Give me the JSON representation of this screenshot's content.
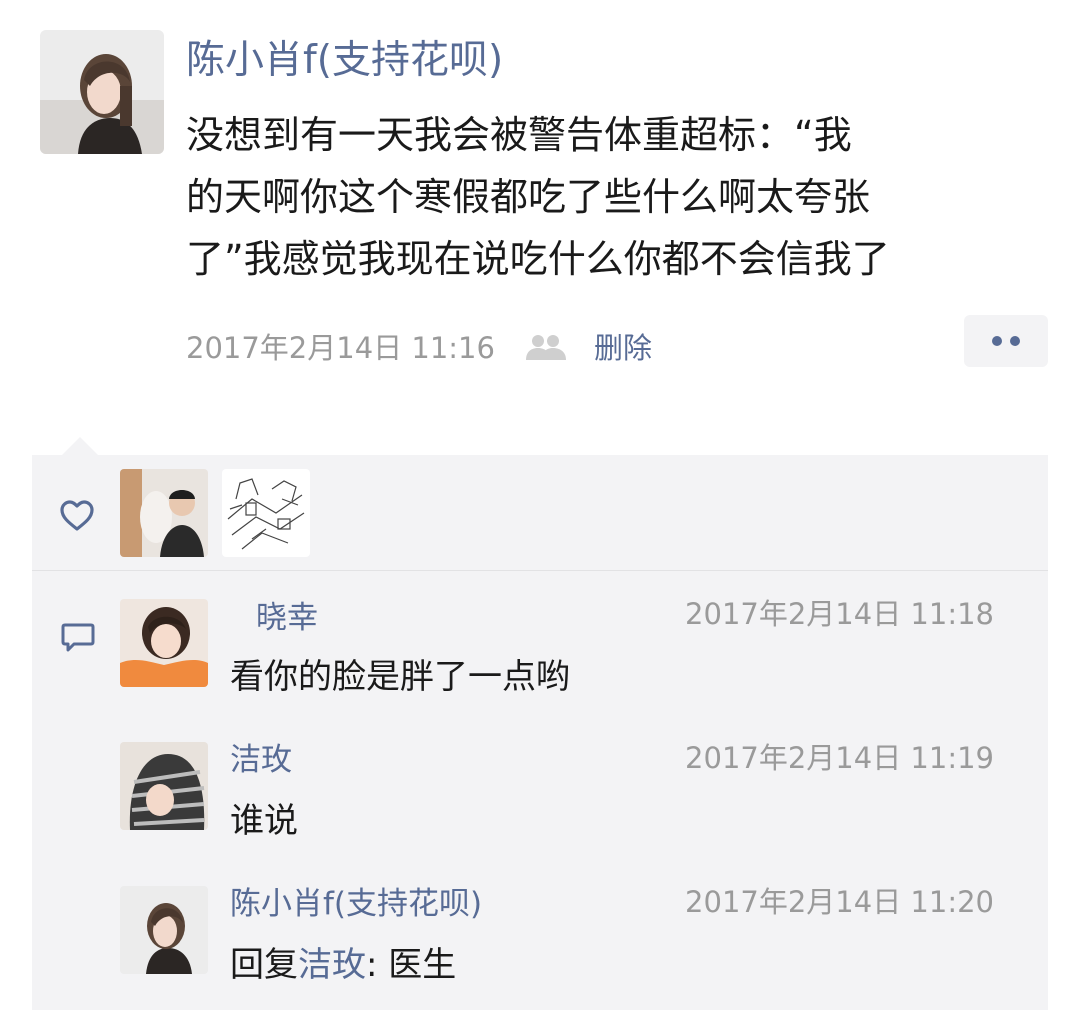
{
  "post": {
    "author_name": "陈小肖f(支持花呗)",
    "text_lines": [
      "没想到有一天我会被警告体重超标：“我",
      "的天啊你这个寒假都吃了些什么啊太夸张",
      "了”我感觉我现在说吃什么你都不会信我了"
    ],
    "timestamp": "2017年2月14日 11:16",
    "privacy_icon": "friends-visible-icon",
    "delete_label": "删除",
    "more_icon": "more-dots-icon"
  },
  "likes": {
    "icon": "heart-icon",
    "avatars": [
      "liker-avatar-1",
      "liker-avatar-2"
    ]
  },
  "comments_icon": "comment-icon",
  "comments": [
    {
      "name": "晓幸",
      "time": "2017年2月14日 11:18",
      "text": "看你的脸是胖了一点哟"
    },
    {
      "name": "洁玫",
      "time": "2017年2月14日 11:19",
      "text": "谁说"
    },
    {
      "name": "陈小肖f(支持花呗)",
      "time": "2017年2月14日 11:20",
      "reply_prefix": "回复",
      "reply_to": "洁玫",
      "reply_sep": ": ",
      "text": "医生"
    }
  ],
  "colors": {
    "link": "#576b95",
    "panel_bg": "#f3f3f5",
    "meta_gray": "#9a9a9a",
    "text": "#1a1a1a"
  }
}
